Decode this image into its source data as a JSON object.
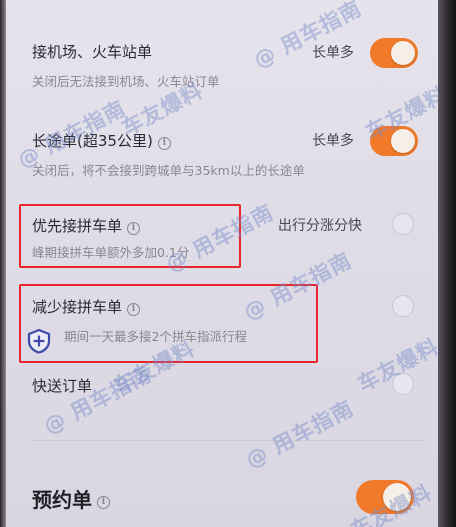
{
  "settings": {
    "airport": {
      "title": "接机场、火车站单",
      "desc": "关闭后无法接到机场、火车站订单",
      "right": "长单多",
      "enabled": true
    },
    "long_distance": {
      "title": "长途单(超35公里)",
      "desc": "关闭后，将不会接到跨城单与35km以上的长途单",
      "right": "长单多",
      "enabled": true
    },
    "carpool_priority": {
      "title": "优先接拼车单",
      "desc": "峰期接拼车单额外多加0.1分",
      "right": "出行分涨分快",
      "enabled": false
    },
    "carpool_reduce": {
      "title": "减少接拼车单",
      "desc": "期间一天最多接2个拼车指派行程",
      "enabled": false
    },
    "express": {
      "title": "快送订单",
      "enabled": false
    },
    "reservation": {
      "title": "预约单",
      "enabled": true
    }
  },
  "watermark": {
    "text1": "@ 用车指南",
    "text2": "车友爆料"
  },
  "colors": {
    "toggle_on": "#f0792a",
    "highlight": "#e8262c"
  }
}
